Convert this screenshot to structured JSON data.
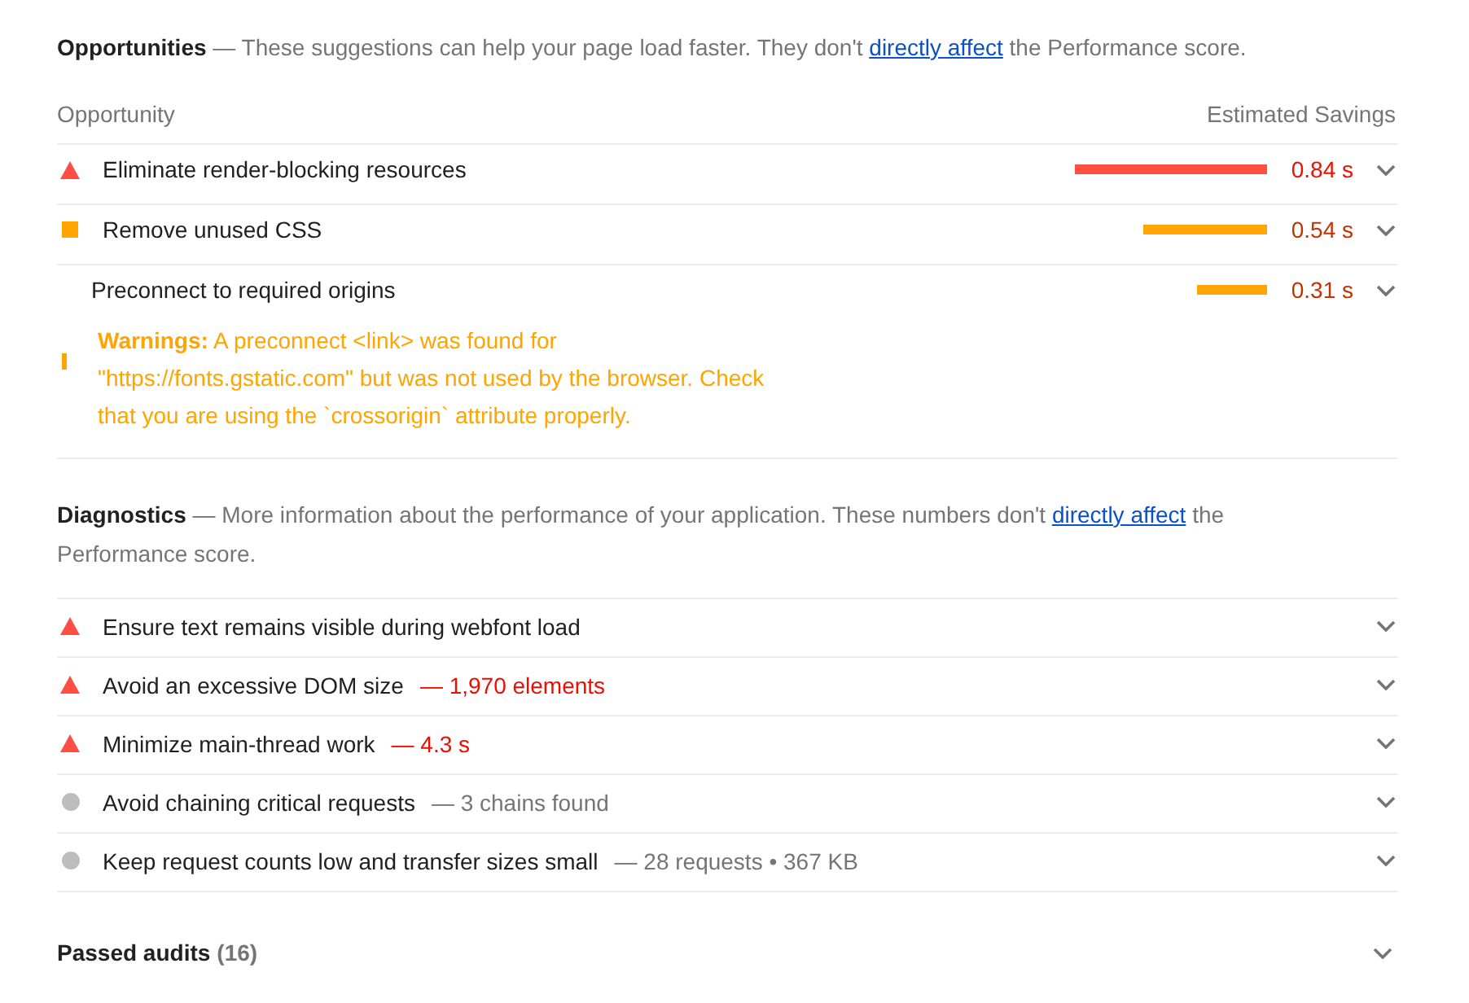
{
  "opportunities": {
    "title": "Opportunities",
    "description": "— These suggestions can help your page load faster. They don't",
    "link": "directly affect",
    "description_after": "the Performance score.",
    "columns": [
      "Opportunity",
      "Estimated Savings"
    ],
    "rows": [
      {
        "title": "Eliminate render-blocking resources",
        "kind": "fail",
        "level": 0.84,
        "savings": "0.84 s",
        "expanded": false
      },
      {
        "title": "Remove unused CSS",
        "kind": "average",
        "level": 0.54,
        "savings": "0.54 s",
        "expanded": false
      },
      {
        "title": "Preconnect to required origins",
        "kind": "warning",
        "level": 0.31,
        "savings": "0.31 s",
        "expanded": false,
        "warning": "**Warnings:** A preconnect <link> was found for \"https://fonts.gstatic.com\" but was not used by the browser. Check that you are using the `crossorigin` attribute properly."
      }
    ]
  },
  "diagnostics": {
    "title": "Diagnostics",
    "description": "— More information about the performance of your application. These numbers don't",
    "link": "directly affect",
    "description_after": "the Performance score.",
    "rows": [
      {
        "title": "Ensure text remains visible during webfont load",
        "kind": "fail",
        "expanded": false
      },
      {
        "title": "Avoid an excessive DOM size",
        "kind": "fail",
        "detail": "— 1,970 elements",
        "expanded": false
      },
      {
        "title": "Minimize main-thread work",
        "kind": "fail",
        "detail": "— 4.3 s",
        "expanded": false
      },
      {
        "title": "Avoid chaining critical requests",
        "kind": "informative",
        "detail": "— 3 chains found",
        "expanded": false
      },
      {
        "title": "Keep request counts low and transfer sizes small",
        "kind": "informative",
        "detail": "— 28 requests • 367 KB",
        "expanded": false
      }
    ]
  },
  "passed_audits": {
    "title": "Passed audits",
    "count": "(16)",
    "expanded": false
  }
}
